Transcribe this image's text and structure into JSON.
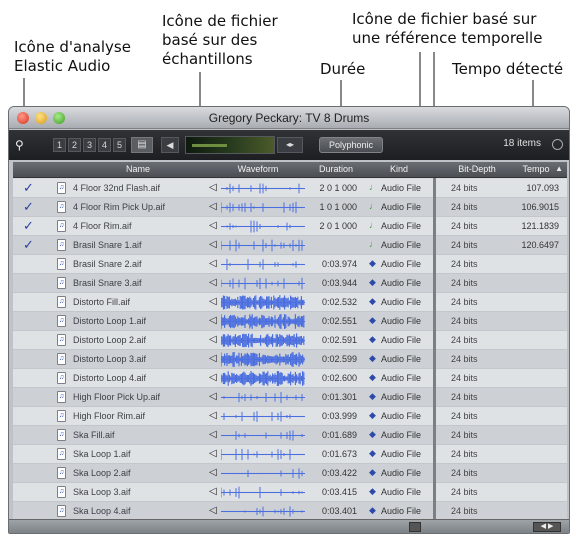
{
  "callouts": {
    "elastic": "Icône d'analyse\nElastic Audio",
    "samples": "Icône de fichier\nbasé sur des\néchantillons",
    "duree": "Durée",
    "tick": "Icône de fichier basé sur\nune référence temporelle",
    "tempo": "Tempo détecté"
  },
  "window": {
    "title": "Gregory Peckary: TV 8 Drums",
    "item_count": "18 items"
  },
  "toolbar": {
    "search_icon": "magnifier-icon",
    "numbers": [
      "1",
      "2",
      "3",
      "4",
      "5"
    ],
    "preview_label": "Polyphonic"
  },
  "columns": {
    "name": "Name",
    "waveform": "Waveform",
    "duration": "Duration",
    "kind": "Kind",
    "bit_depth": "Bit-Depth",
    "tempo": "Tempo"
  },
  "rows": [
    {
      "checked": true,
      "name": "4 Floor 32nd Flash.aif",
      "duration": "2 0 1 000",
      "kind": "Audio File",
      "kind_icon": "tick-based",
      "bit_depth": "24 bits",
      "tempo": "107.093",
      "wave": "thin"
    },
    {
      "checked": true,
      "name": "4 Floor Rim Pick Up.aif",
      "duration": "1 0 1 000",
      "kind": "Audio File",
      "kind_icon": "tick-based",
      "bit_depth": "24 bits",
      "tempo": "106.9015",
      "wave": "thin"
    },
    {
      "checked": true,
      "name": "4 Floor Rim.aif",
      "duration": "2 0 1 000",
      "kind": "Audio File",
      "kind_icon": "tick-based",
      "bit_depth": "24 bits",
      "tempo": "121.1839",
      "wave": "thin"
    },
    {
      "checked": true,
      "name": "Brasil Snare 1.aif",
      "duration": "",
      "kind": "Audio File",
      "kind_icon": "tick-based",
      "bit_depth": "24 bits",
      "tempo": "120.6497",
      "wave": "thin"
    },
    {
      "checked": false,
      "name": "Brasil Snare 2.aif",
      "duration": "0:03.974",
      "kind": "Audio File",
      "kind_icon": "sample-based",
      "bit_depth": "24 bits",
      "tempo": "",
      "wave": "thin"
    },
    {
      "checked": false,
      "name": "Brasil Snare 3.aif",
      "duration": "0:03.944",
      "kind": "Audio File",
      "kind_icon": "sample-based",
      "bit_depth": "24 bits",
      "tempo": "",
      "wave": "thin"
    },
    {
      "checked": false,
      "name": "Distorto Fill.aif",
      "duration": "0:02.532",
      "kind": "Audio File",
      "kind_icon": "sample-based",
      "bit_depth": "24 bits",
      "tempo": "",
      "wave": "dense"
    },
    {
      "checked": false,
      "name": "Distorto Loop 1.aif",
      "duration": "0:02.551",
      "kind": "Audio File",
      "kind_icon": "sample-based",
      "bit_depth": "24 bits",
      "tempo": "",
      "wave": "dense"
    },
    {
      "checked": false,
      "name": "Distorto Loop 2.aif",
      "duration": "0:02.591",
      "kind": "Audio File",
      "kind_icon": "sample-based",
      "bit_depth": "24 bits",
      "tempo": "",
      "wave": "dense"
    },
    {
      "checked": false,
      "name": "Distorto Loop 3.aif",
      "duration": "0:02.599",
      "kind": "Audio File",
      "kind_icon": "sample-based",
      "bit_depth": "24 bits",
      "tempo": "",
      "wave": "dense"
    },
    {
      "checked": false,
      "name": "Distorto Loop 4.aif",
      "duration": "0:02.600",
      "kind": "Audio File",
      "kind_icon": "sample-based",
      "bit_depth": "24 bits",
      "tempo": "",
      "wave": "dense"
    },
    {
      "checked": false,
      "name": "High Floor Pick Up.aif",
      "duration": "0:01.301",
      "kind": "Audio File",
      "kind_icon": "sample-based",
      "bit_depth": "24 bits",
      "tempo": "",
      "wave": "thin"
    },
    {
      "checked": false,
      "name": "High Floor Rim.aif",
      "duration": "0:03.999",
      "kind": "Audio File",
      "kind_icon": "sample-based",
      "bit_depth": "24 bits",
      "tempo": "",
      "wave": "thin"
    },
    {
      "checked": false,
      "name": "Ska Fill.aif",
      "duration": "0:01.689",
      "kind": "Audio File",
      "kind_icon": "sample-based",
      "bit_depth": "24 bits",
      "tempo": "",
      "wave": "thin"
    },
    {
      "checked": false,
      "name": "Ska Loop 1.aif",
      "duration": "0:01.673",
      "kind": "Audio File",
      "kind_icon": "sample-based",
      "bit_depth": "24 bits",
      "tempo": "",
      "wave": "thin"
    },
    {
      "checked": false,
      "name": "Ska Loop 2.aif",
      "duration": "0:03.422",
      "kind": "Audio File",
      "kind_icon": "sample-based",
      "bit_depth": "24 bits",
      "tempo": "",
      "wave": "thin"
    },
    {
      "checked": false,
      "name": "Ska Loop 3.aif",
      "duration": "0:03.415",
      "kind": "Audio File",
      "kind_icon": "sample-based",
      "bit_depth": "24 bits",
      "tempo": "",
      "wave": "thin"
    },
    {
      "checked": false,
      "name": "Ska Loop 4.aif",
      "duration": "0:03.401",
      "kind": "Audio File",
      "kind_icon": "sample-based",
      "bit_depth": "24 bits",
      "tempo": "",
      "wave": "thin"
    }
  ],
  "colors": {
    "check": "#2a3fa0",
    "waveform": "#4c6fe0",
    "tick_icon": "#2f8a2a",
    "sample_icon": "#2e4aa8"
  }
}
